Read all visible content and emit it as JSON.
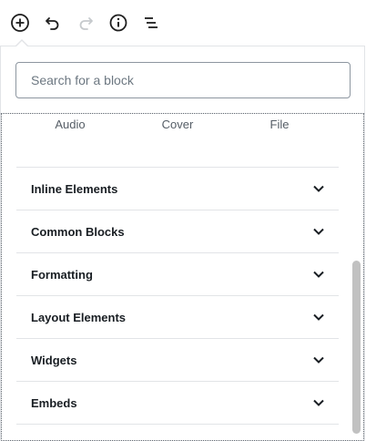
{
  "toolbar": {
    "items": [
      {
        "name": "add-block",
        "icon": "plus-circle-icon"
      },
      {
        "name": "undo",
        "icon": "undo-icon"
      },
      {
        "name": "redo",
        "icon": "redo-icon"
      },
      {
        "name": "info",
        "icon": "info-icon"
      },
      {
        "name": "block-navigation",
        "icon": "list-icon"
      }
    ]
  },
  "search": {
    "placeholder": "Search for a block"
  },
  "recent_blocks": [
    "Audio",
    "Cover",
    "File"
  ],
  "sections": [
    {
      "title": "Inline Elements"
    },
    {
      "title": "Common Blocks"
    },
    {
      "title": "Formatting"
    },
    {
      "title": "Layout Elements"
    },
    {
      "title": "Widgets"
    },
    {
      "title": "Embeds"
    }
  ],
  "colors": {
    "text": "#191e23",
    "muted": "#555d66",
    "border": "#e2e4e7",
    "disabled_icon": "#c6cacd"
  }
}
